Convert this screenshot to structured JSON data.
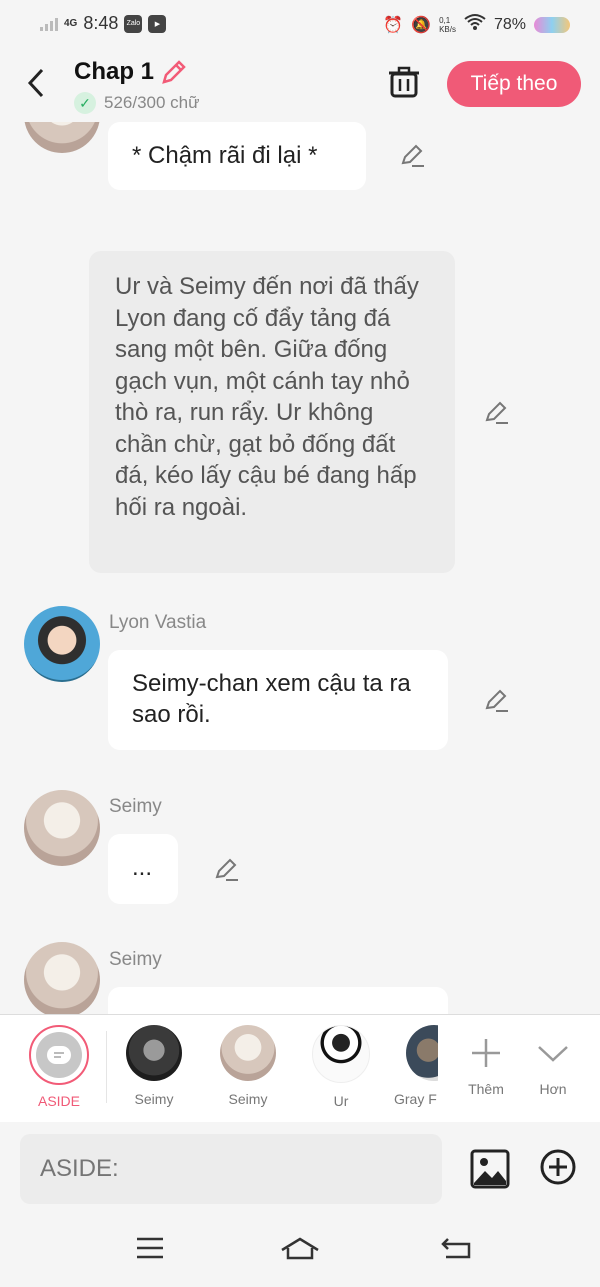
{
  "status": {
    "network": "4G",
    "time": "8:48",
    "apps": [
      "Zalo",
      "▶"
    ],
    "speed_value": "0,1",
    "speed_unit": "KB/s",
    "battery": "78%"
  },
  "header": {
    "title": "Chap 1",
    "word_count": "526/300 chữ",
    "next_label": "Tiếp theo"
  },
  "chat": {
    "msg1": "* Chậm rãi đi lại *",
    "narration": "Ur và Seimy đến nơi đã thấy Lyon đang cố đẩy tảng đá sang một bên. Giữa đống gạch vụn, một cánh tay nhỏ thò ra, run rẩy. Ur không chần chừ, gạt bỏ đống đất đá, kéo lấy cậu bé đang hấp hối ra ngoài.",
    "speaker2": "Lyon Vastia",
    "msg2": "Seimy-chan xem cậu ta ra sao rồi.",
    "speaker3": "Seimy",
    "msg3": "...",
    "speaker4": "Seimy"
  },
  "characters": {
    "items": [
      {
        "label": "ASIDE"
      },
      {
        "label": "Seimy"
      },
      {
        "label": "Seimy"
      },
      {
        "label": "Ur"
      },
      {
        "label": "Gray F"
      },
      {
        "label": "Thêm"
      },
      {
        "label": "Hơn"
      }
    ]
  },
  "composer": {
    "placeholder": "ASIDE:"
  },
  "colors": {
    "accent": "#f05a77",
    "bg": "#f5f5f5",
    "narration_bg": "#ececec",
    "bubble_bg": "#ffffff"
  },
  "icons": [
    "back-icon",
    "pencil-icon",
    "check-icon",
    "trash-icon",
    "edit-icon",
    "plus-icon",
    "chevron-down-icon",
    "image-icon",
    "plus-circle-icon",
    "menu-icon",
    "home-icon",
    "back-nav-icon"
  ]
}
